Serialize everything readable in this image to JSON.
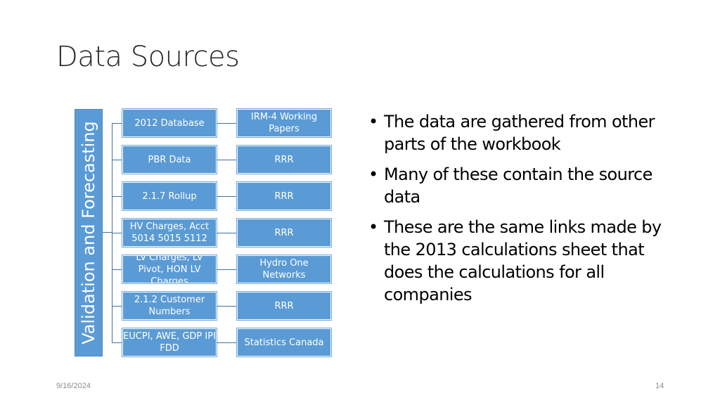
{
  "slide": {
    "title": "Data Sources",
    "footer_date": "9/16/2024",
    "page_number": "14"
  },
  "diagram": {
    "root_label": "Validation and Forecasting",
    "colors": {
      "node_fill": "#5b9bd5",
      "connector": "#41719c",
      "node_text": "#ffffff"
    },
    "rows": [
      {
        "source": "2012 Database",
        "origin": "IRM-4 Working Papers"
      },
      {
        "source": "PBR Data",
        "origin": "RRR"
      },
      {
        "source": "2.1.7 Rollup",
        "origin": "RRR"
      },
      {
        "source": "HV Charges, Acct 5014 5015 5112",
        "origin": "RRR"
      },
      {
        "source": "LV Charges, LV Pivot, HON LV Charges",
        "origin": "Hydro One Networks"
      },
      {
        "source": "2.1.2 Customer Numbers",
        "origin": "RRR"
      },
      {
        "source": "EUCPI, AWE, GDP IPI FDD",
        "origin": "Statistics Canada"
      }
    ]
  },
  "bullets": [
    "The data are gathered from other parts of the workbook",
    "Many of these contain the source data",
    "These are the same links made by the 2013 calculations sheet that does the calculations for all companies"
  ],
  "bullet_glyph": "•"
}
